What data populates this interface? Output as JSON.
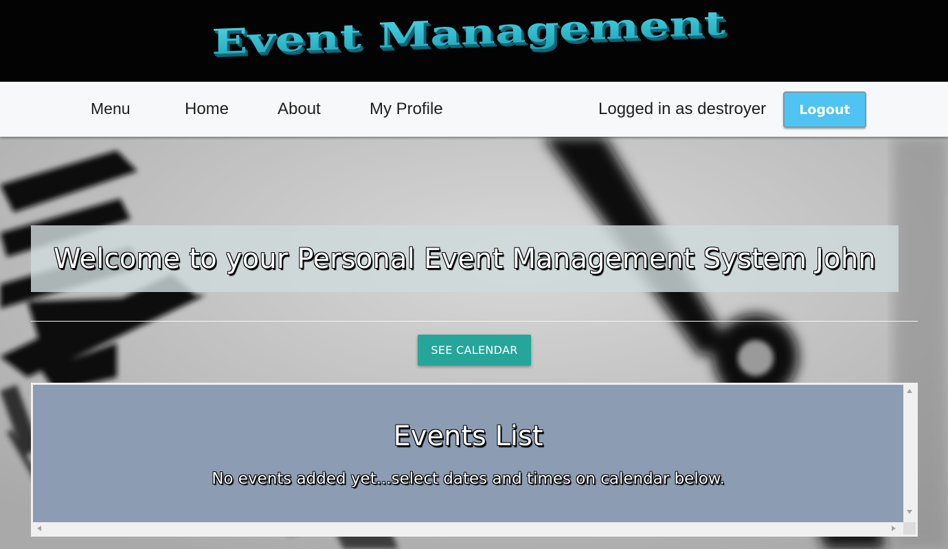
{
  "header": {
    "logo_text": "Event Management"
  },
  "nav": {
    "menu_label": "Menu",
    "home_label": "Home",
    "about_label": "About",
    "profile_label": "My Profile",
    "logged_in_text": "Logged in as destroyer",
    "logout_label": "Logout"
  },
  "main": {
    "welcome_text": "Welcome to your Personal Event Management System John",
    "calendar_button_label": "SEE CALENDAR",
    "events": {
      "title": "Events List",
      "empty_message": "No events added yet...select dates and times on calendar below."
    }
  },
  "colors": {
    "header_bg": "#030303",
    "logo_cyan": "#2ab7cc",
    "nav_bg": "#f7f8f9",
    "logout_bg": "#4fc3f1",
    "calendar_btn_bg": "#26a69a",
    "events_bg": "#8b9cb3"
  },
  "icons": [
    "scroll-up-arrow-icon",
    "scroll-down-arrow-icon",
    "scroll-left-arrow-icon",
    "scroll-right-arrow-icon"
  ]
}
